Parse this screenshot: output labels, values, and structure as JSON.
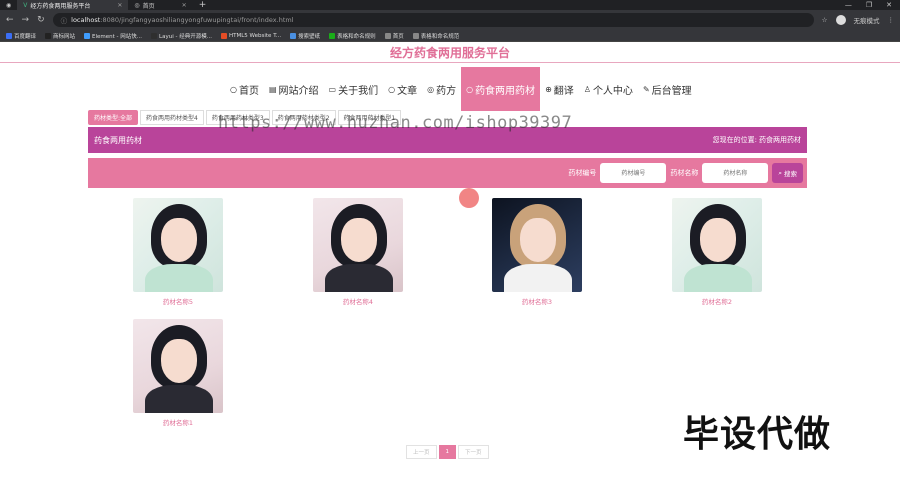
{
  "browser": {
    "tabs": [
      {
        "title": "经方药食两用服务平台",
        "active": true
      },
      {
        "title": "首页",
        "active": false
      }
    ],
    "new_tab": "+",
    "url_host": "localhost",
    "url_rest": ":8080/jingfangyaoshiliangyongfuwupingtai/front/index.html",
    "profile_label": "无痕模式",
    "bookmarks": [
      {
        "label": "百度翻译",
        "color": "#3b6ef5"
      },
      {
        "label": "商标网站",
        "color": "#222222"
      },
      {
        "label": "Element - 网站快...",
        "color": "#409eff"
      },
      {
        "label": "Layui - 经典开源模...",
        "color": "#2f2f2f"
      },
      {
        "label": "HTML5 Website T...",
        "color": "#e44d26"
      },
      {
        "label": "搜索壁纸",
        "color": "#4a90e2"
      },
      {
        "label": "表格和命名规则",
        "color": "#1aad19"
      },
      {
        "label": "首页",
        "color": "#888888"
      },
      {
        "label": "表格和命名规范",
        "color": "#888888"
      }
    ]
  },
  "site": {
    "title": "经方药食两用服务平台",
    "nav": [
      {
        "icon": "○",
        "label": "首页",
        "active": false
      },
      {
        "icon": "▤",
        "label": "网站介绍",
        "active": false
      },
      {
        "icon": "▭",
        "label": "关于我们",
        "active": false
      },
      {
        "icon": "○",
        "label": "文章",
        "active": false
      },
      {
        "icon": "◎",
        "label": "药方",
        "active": false
      },
      {
        "icon": "○",
        "label": "药食两用药材",
        "active": true
      },
      {
        "icon": "⊕",
        "label": "翻译",
        "active": false
      },
      {
        "icon": "♙",
        "label": "个人中心",
        "active": false
      },
      {
        "icon": "✎",
        "label": "后台管理",
        "active": false
      }
    ],
    "subtabs": [
      {
        "label": "药材类型:全部",
        "active": true
      },
      {
        "label": "药食两用药材类型4",
        "active": false
      },
      {
        "label": "药食两用药材类型3",
        "active": false
      },
      {
        "label": "药食两用药材类型2",
        "active": false
      },
      {
        "label": "药食两用药材类型1",
        "active": false
      }
    ],
    "banner": {
      "title": "药食两用药材",
      "location_prefix": "您现在的位置:",
      "location_current": "药食两用药材"
    },
    "search": {
      "code_label": "药材编号",
      "code_placeholder": "药材编号",
      "name_label": "药材名称",
      "name_placeholder": "药材名称",
      "button_label": "搜索"
    },
    "items": [
      {
        "name": "药材名称5",
        "style": "light"
      },
      {
        "name": "药材名称4",
        "style": "dark"
      },
      {
        "name": "药材名称3",
        "style": "blue"
      },
      {
        "name": "药材名称2",
        "style": "light"
      },
      {
        "name": "药材名称1",
        "style": "dark"
      }
    ],
    "pager": {
      "prev": "上一页",
      "current": "1",
      "next": "下一页"
    }
  },
  "watermark": "https://www.huzhan.com/ishop39397",
  "overlay_text": "毕设代做"
}
